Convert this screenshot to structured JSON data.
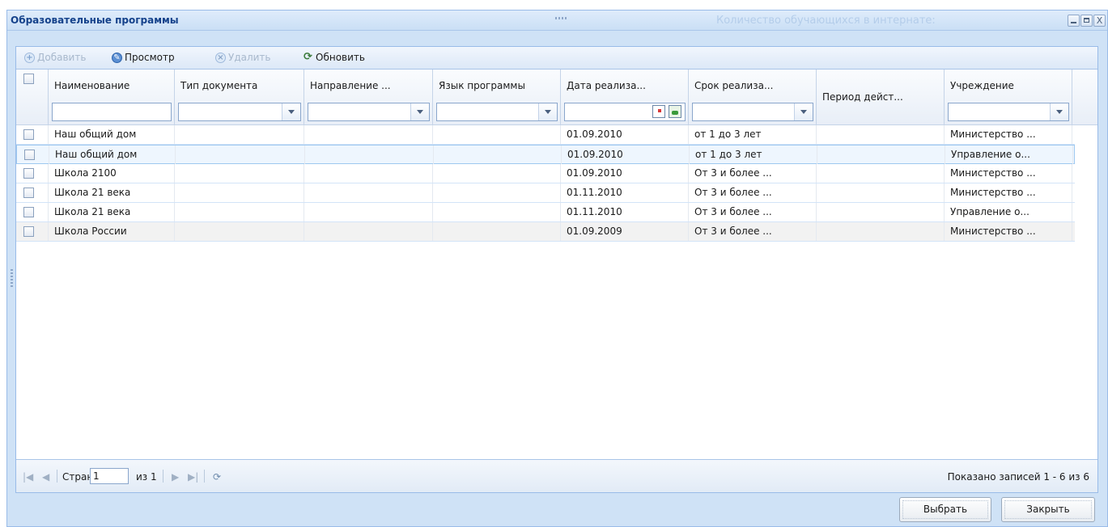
{
  "window": {
    "title": "Образовательные программы",
    "ghost_text": "Количество обучающихся в интернате:",
    "controls": {
      "close": "X"
    }
  },
  "toolbar": {
    "add": "Добавить",
    "view": "Просмотр",
    "delete": "Удалить",
    "refresh": "Обновить"
  },
  "columns": [
    {
      "label": "Наименование"
    },
    {
      "label": "Тип документа"
    },
    {
      "label": "Направление ..."
    },
    {
      "label": "Язык программы"
    },
    {
      "label": "Дата реализа..."
    },
    {
      "label": "Срок реализа..."
    },
    {
      "label": "Период дейст..."
    },
    {
      "label": "Учреждение"
    }
  ],
  "rows": [
    {
      "name": "Наш общий дом",
      "doc_type": "",
      "direction": "",
      "language": "",
      "date": "01.09.2010",
      "term": "от 1 до 3 лет",
      "period": "",
      "institution": "Министерство ..."
    },
    {
      "name": "Наш общий дом",
      "doc_type": "",
      "direction": "",
      "language": "",
      "date": "01.09.2010",
      "term": "от 1 до 3 лет",
      "period": "",
      "institution": "Управление о..."
    },
    {
      "name": "Школа 2100",
      "doc_type": "",
      "direction": "",
      "language": "",
      "date": "01.09.2010",
      "term": "От 3 и более ...",
      "period": "",
      "institution": "Министерство ..."
    },
    {
      "name": "Школа 21 века",
      "doc_type": "",
      "direction": "",
      "language": "",
      "date": "01.11.2010",
      "term": "От 3 и более ...",
      "period": "",
      "institution": "Министерство ..."
    },
    {
      "name": "Школа 21 века",
      "doc_type": "",
      "direction": "",
      "language": "",
      "date": "01.11.2010",
      "term": "От 3 и более ...",
      "period": "",
      "institution": "Управление о..."
    },
    {
      "name": "Школа России",
      "doc_type": "",
      "direction": "",
      "language": "",
      "date": "01.09.2009",
      "term": "От 3 и более ...",
      "period": "",
      "institution": "Министерство ..."
    }
  ],
  "pager": {
    "page_label": "Страница",
    "page_value": "1",
    "of_label": "из 1",
    "summary": "Показано записей 1 - 6 из 6"
  },
  "buttons": {
    "select": "Выбрать",
    "close": "Закрыть"
  },
  "colors": {
    "accent": "#15428b",
    "window_bg": "#cfe2f6",
    "border": "#99bbe8"
  }
}
